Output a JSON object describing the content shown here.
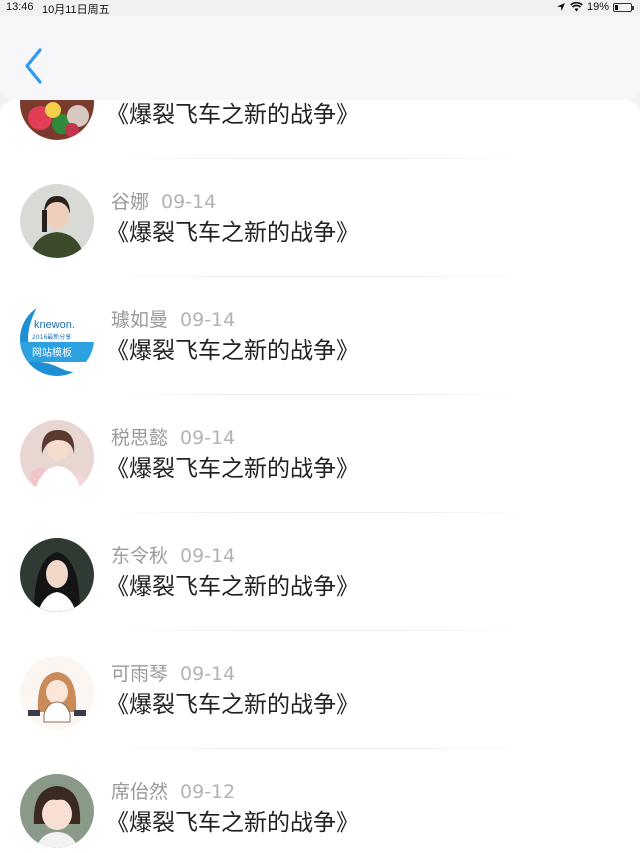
{
  "status_bar": {
    "time": "13:46",
    "date": "10月11日周五",
    "battery": "19%",
    "battery_level": 0.19
  },
  "navbar": {
    "back_icon": "chevron-left-icon",
    "accent_color": "#2f9bf0"
  },
  "messages": [
    {
      "name": "",
      "date": "",
      "text": "《爆裂飞车之新的战争》",
      "avatar": "flowers"
    },
    {
      "name": "谷娜",
      "date": "09-14",
      "text": "《爆裂飞车之新的战争》",
      "avatar": "woman-dark-jacket"
    },
    {
      "name": "璩如曼",
      "date": "09-14",
      "text": "《爆裂飞车之新的战争》",
      "avatar": "logo-knewone"
    },
    {
      "name": "税思懿",
      "date": "09-14",
      "text": "《爆裂飞车之新的战争》",
      "avatar": "woman-pink"
    },
    {
      "name": "东令秋",
      "date": "09-14",
      "text": "《爆裂飞车之新的战争》",
      "avatar": "woman-dark-hair"
    },
    {
      "name": "可雨琴",
      "date": "09-14",
      "text": "《爆裂飞车之新的战争》",
      "avatar": "cartoon-girl"
    },
    {
      "name": "席佁然",
      "date": "09-12",
      "text": "《爆裂飞车之新的战争》",
      "avatar": "child"
    }
  ],
  "avatar_logo_text": {
    "line1": "knewon.",
    "line2": "2016最新分享",
    "line3": "网站模板"
  }
}
